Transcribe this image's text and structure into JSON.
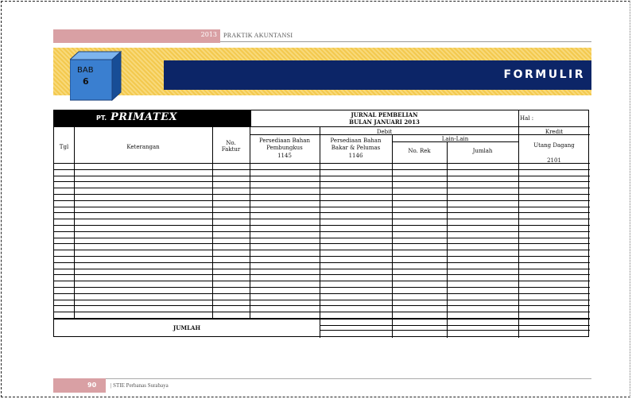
{
  "header": {
    "year": "2013",
    "title": "PRAKTIK AKUNTANSI"
  },
  "chapter": {
    "label": "BAB",
    "number": "6"
  },
  "banner": {
    "title": "FORMULIR"
  },
  "form": {
    "company_prefix": "PT.",
    "company_name": "PRIMATEX",
    "journal_title": "JURNAL PEMBELIAN",
    "journal_period": "BULAN JANUARI 2013",
    "page_ref_label": "Hal :",
    "debit_label": "Debit",
    "credit_label": "Kredit",
    "lain_lain_label": "Lain-Lain",
    "columns": {
      "tgl": "Tgl",
      "keterangan": "Keterangan",
      "no_faktur_1": "No.",
      "no_faktur_2": "Faktur",
      "persediaan_pembungkus_1": "Persediaan Bahan",
      "persediaan_pembungkus_2": "Pembungkus",
      "persediaan_pembungkus_3": "1145",
      "persediaan_bakar_1": "Persediaan Bahan",
      "persediaan_bakar_2": "Bakar & Pelumas",
      "persediaan_bakar_3": "1146",
      "no_rek": "No. Rek",
      "jumlah": "Jumlah",
      "utang_dagang_1": "Utang Dagang",
      "utang_dagang_2": "2101"
    },
    "total_label": "JUMLAH"
  },
  "footer": {
    "page_number": "90",
    "text": "| STIE Perbanas Surabaya"
  }
}
